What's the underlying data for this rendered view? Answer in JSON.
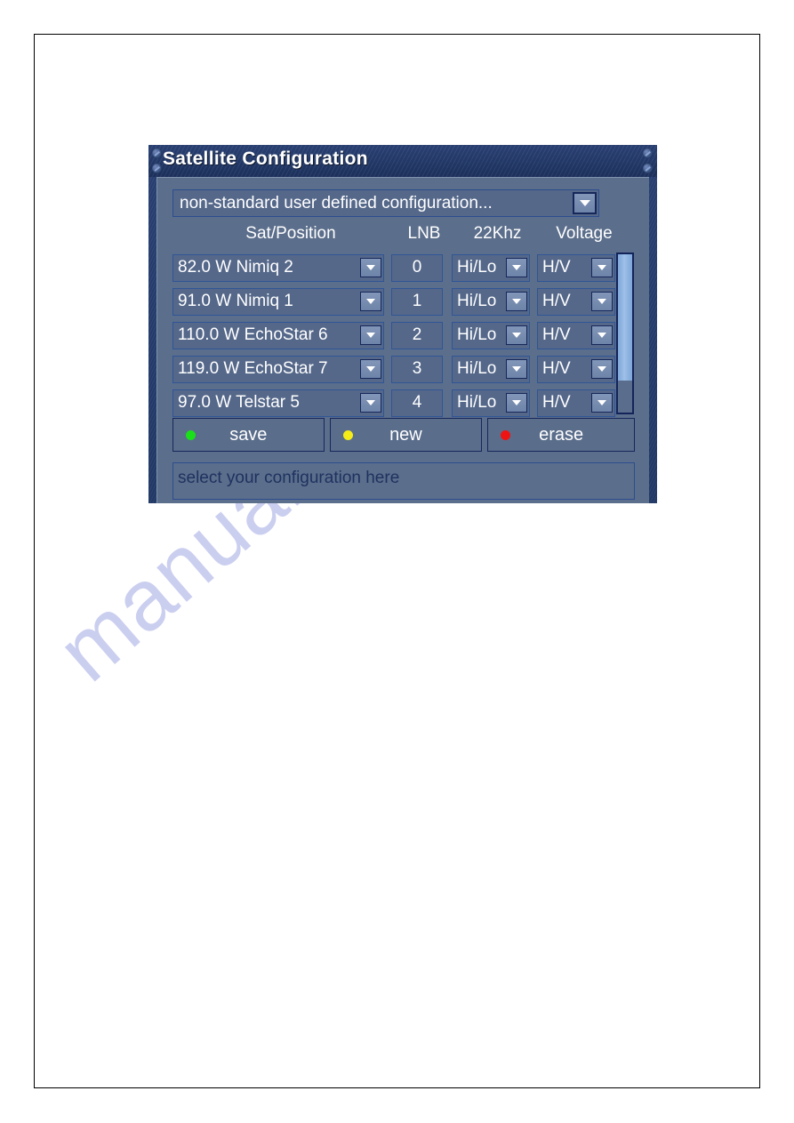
{
  "window": {
    "title": "Satellite Configuration",
    "rivet_icon": "screw-rivet-icon"
  },
  "config_select": {
    "value": "non-standard user defined configuration...",
    "arrow_icon": "chevron-down-icon"
  },
  "table": {
    "headers": {
      "sat_position": "Sat/Position",
      "lnb": "LNB",
      "khz": "22Khz",
      "voltage": "Voltage"
    },
    "rows": [
      {
        "sat": "82.0 W Nimiq 2",
        "lnb": "0",
        "khz": "Hi/Lo",
        "voltage": "H/V"
      },
      {
        "sat": "91.0 W Nimiq 1",
        "lnb": "1",
        "khz": "Hi/Lo",
        "voltage": "H/V"
      },
      {
        "sat": "110.0 W EchoStar 6",
        "lnb": "2",
        "khz": "Hi/Lo",
        "voltage": "H/V"
      },
      {
        "sat": "119.0 W EchoStar 7",
        "lnb": "3",
        "khz": "Hi/Lo",
        "voltage": "H/V"
      },
      {
        "sat": "97.0 W Telstar 5",
        "lnb": "4",
        "khz": "Hi/Lo",
        "voltage": "H/V"
      }
    ]
  },
  "scrollbar": {
    "thumb_position": "top",
    "thumb_fraction": 0.8
  },
  "buttons": [
    {
      "label": "save",
      "led_color": "#19e019",
      "led_name": "green-led-icon"
    },
    {
      "label": "new",
      "led_color": "#f5ec18",
      "led_name": "yellow-led-icon"
    },
    {
      "label": "erase",
      "led_color": "#ef1414",
      "led_name": "red-led-icon"
    }
  ],
  "status_bar": {
    "text": "select your configuration here"
  },
  "watermark": {
    "text": "manualshive.com"
  },
  "colors": {
    "title_bar": "#2c4478",
    "panel_body": "#5b6e8b",
    "field_bg": "#55688a",
    "field_border": "#2f5596",
    "frame": "#22365f",
    "scroll_thumb": "#9ec0e8",
    "text": "#ffffff",
    "watermark": "#c9cdef"
  }
}
